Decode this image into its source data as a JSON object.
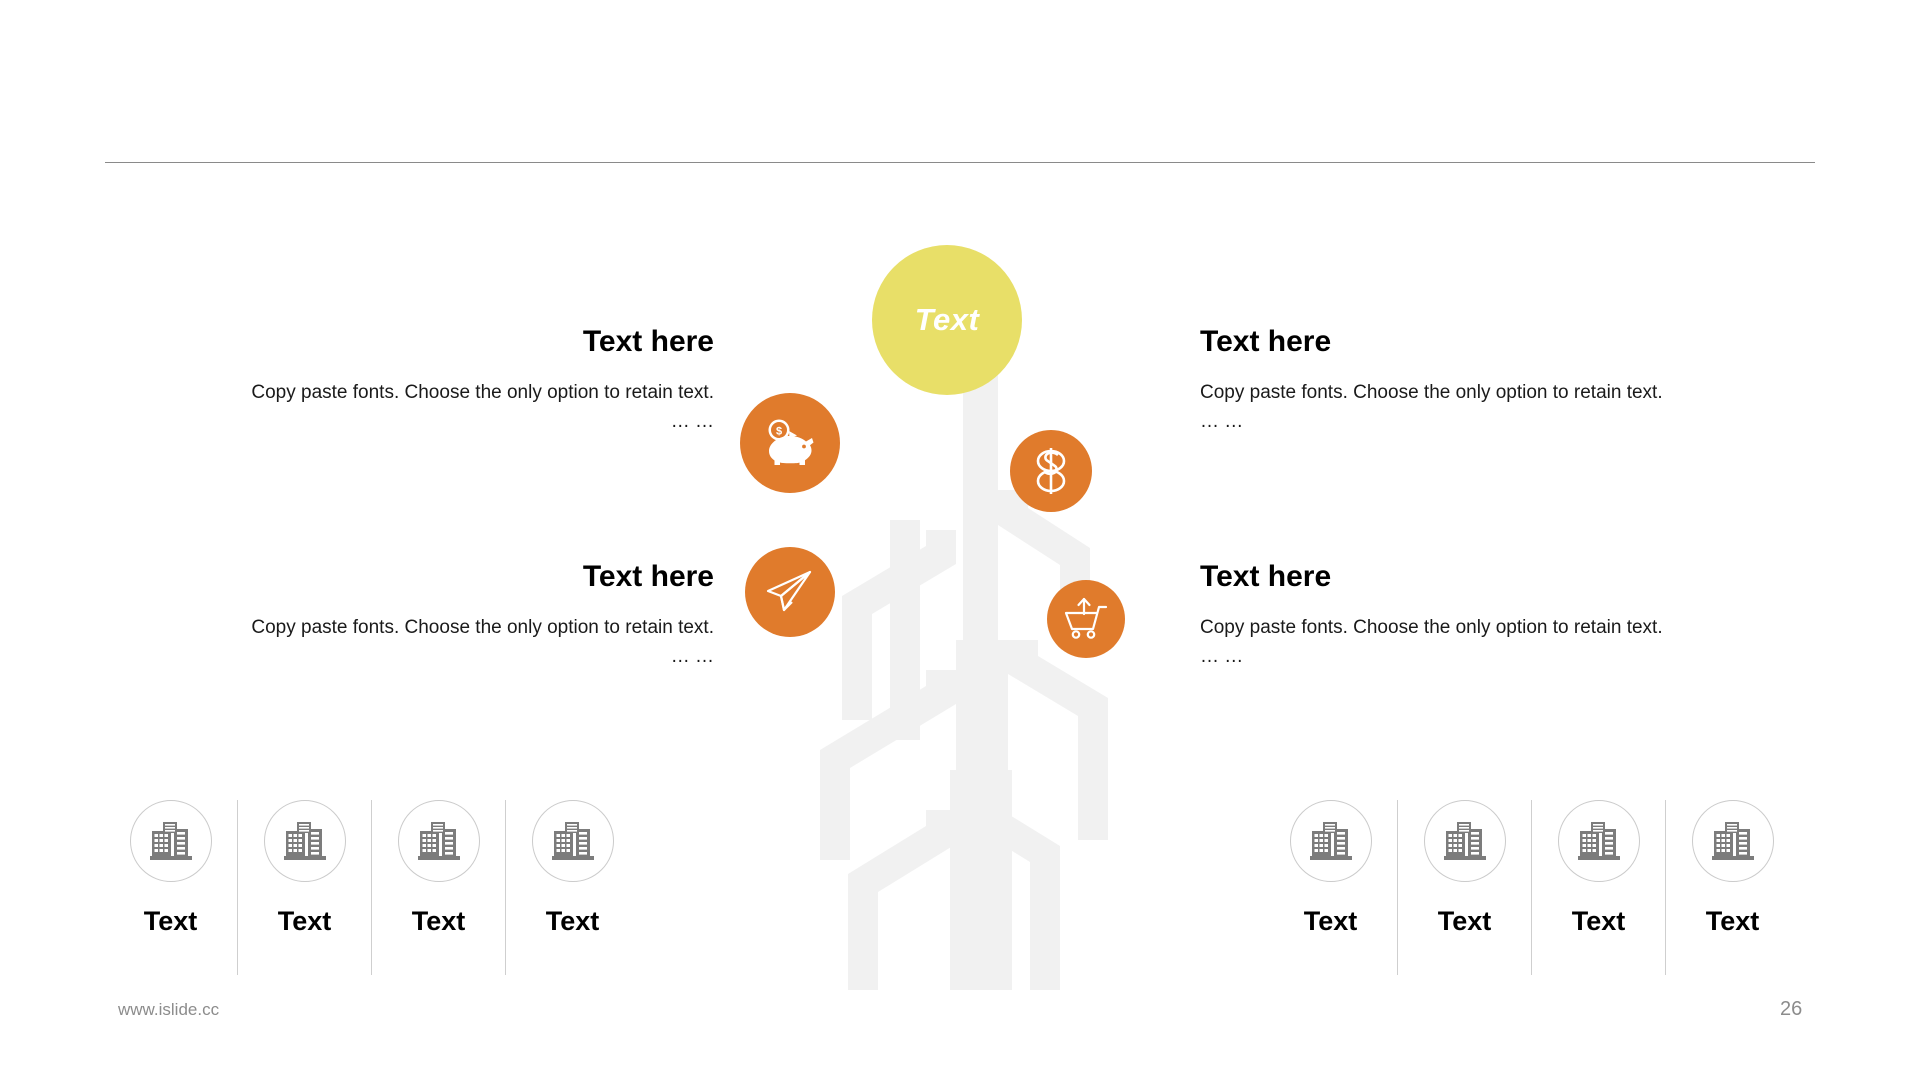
{
  "slide": {
    "page_number": "26",
    "footer_url": "www.islide.cc",
    "colors": {
      "accent_orange": "#e07b2c",
      "accent_yellow": "#e8df68",
      "tree_gray": "#f1f1f1",
      "rule_gray": "#8a8a8a",
      "muted_gray": "#8c8c8c",
      "icon_gray": "#7c7c7c",
      "circle_border": "#cbcbcb"
    }
  },
  "tree": {
    "top_node": {
      "label": "Text",
      "icon": "text-bubble-node"
    },
    "nodes": [
      {
        "id": "piggy",
        "icon": "piggy-bank-icon"
      },
      {
        "id": "dollar",
        "icon": "dollar-sign-icon"
      },
      {
        "id": "plane",
        "icon": "paper-plane-icon"
      },
      {
        "id": "cart",
        "icon": "shopping-cart-up-icon"
      }
    ]
  },
  "content_blocks": {
    "left": [
      {
        "heading": "Text here",
        "body": "Copy paste fonts. Choose the only option to retain text.",
        "ellipsis": "… …"
      },
      {
        "heading": "Text here",
        "body": "Copy paste fonts. Choose the only option to retain text.",
        "ellipsis": "… …"
      }
    ],
    "right": [
      {
        "heading": "Text here",
        "body": "Copy paste fonts. Choose the only option to retain text.",
        "ellipsis": "… …"
      },
      {
        "heading": "Text here",
        "body": "Copy paste fonts. Choose the only option to retain text.",
        "ellipsis": "… …"
      }
    ]
  },
  "bottom_strips": {
    "left": {
      "items": [
        {
          "label": "Text",
          "icon": "buildings-icon"
        },
        {
          "label": "Text",
          "icon": "buildings-icon"
        },
        {
          "label": "Text",
          "icon": "buildings-icon"
        },
        {
          "label": "Text",
          "icon": "buildings-icon"
        }
      ]
    },
    "right": {
      "items": [
        {
          "label": "Text",
          "icon": "buildings-icon"
        },
        {
          "label": "Text",
          "icon": "buildings-icon"
        },
        {
          "label": "Text",
          "icon": "buildings-icon"
        },
        {
          "label": "Text",
          "icon": "buildings-icon"
        }
      ]
    }
  }
}
